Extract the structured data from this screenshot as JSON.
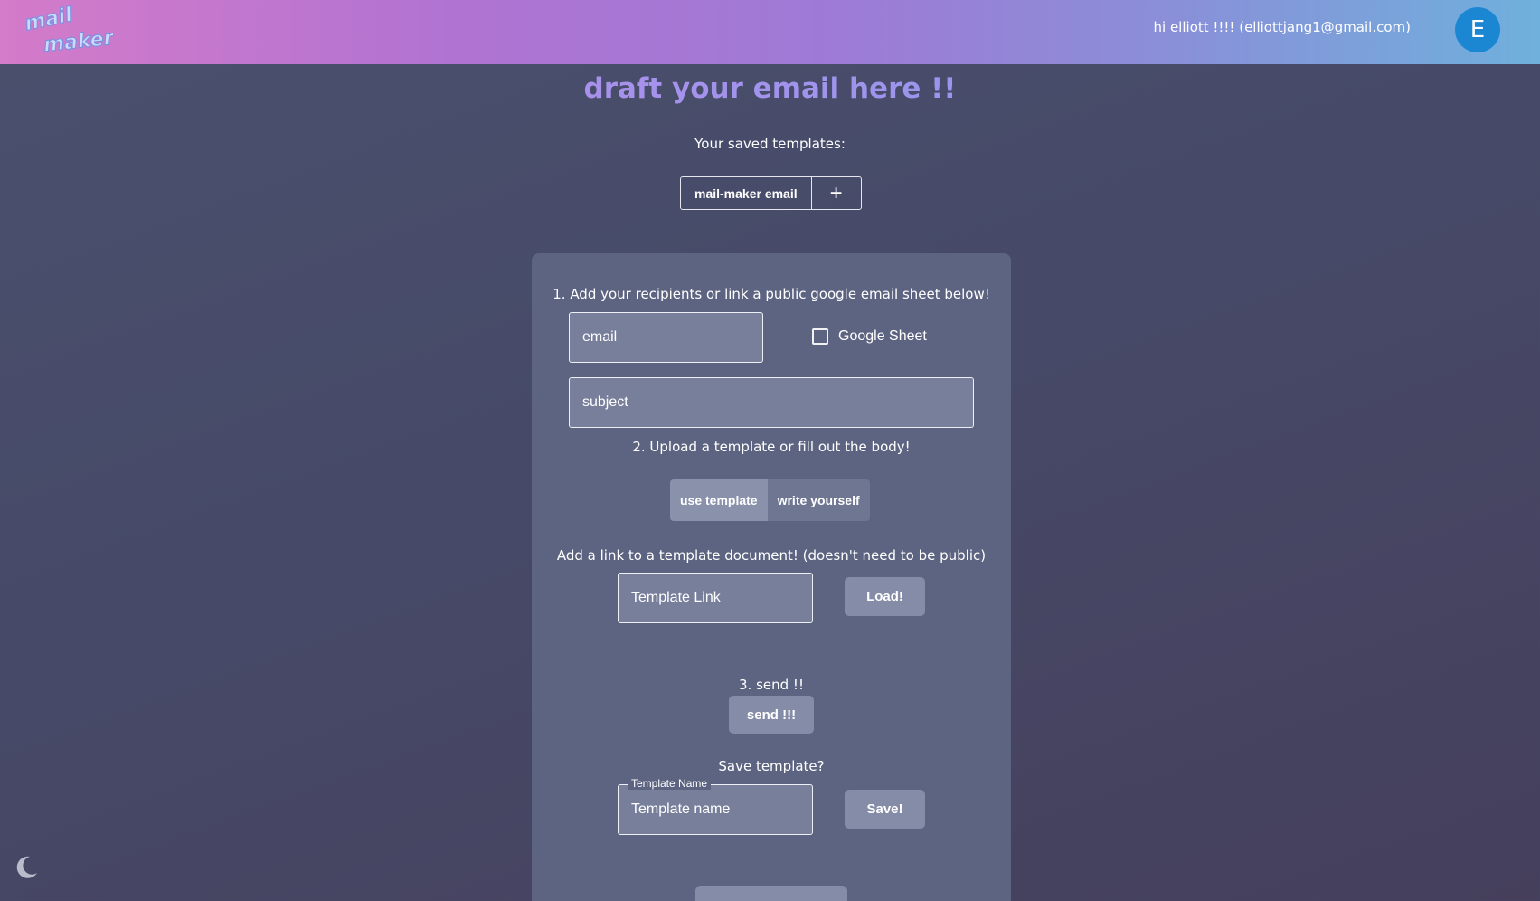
{
  "header": {
    "logo_text": "mail maker",
    "greeting": "hi elliott !!!! (elliottjang1@gmail.com)",
    "avatar_initial": "E"
  },
  "main": {
    "title": "draft your email here !!",
    "saved_templates_label": "Your saved templates:",
    "saved_templates": [
      "mail-maker email"
    ],
    "add_template_symbol": "+"
  },
  "form": {
    "step1": "1. Add your recipients or link a public google email sheet below!",
    "email_placeholder": "email",
    "google_sheet_label": "Google Sheet",
    "subject_placeholder": "subject",
    "step2": "2. Upload a template or fill out the body!",
    "mode_options": [
      "use template",
      "write yourself"
    ],
    "mode_selected": "use template",
    "template_hint": "Add a link to a template document! (doesn't need to be public)",
    "template_link_placeholder": "Template Link",
    "load_button": "Load!",
    "step3": "3. send !!",
    "send_button": "send !!!",
    "save_prompt": "Save template?",
    "template_name_label": "Template Name",
    "template_name_placeholder": "Template name",
    "save_button": "Save!"
  },
  "colors": {
    "accent_avatar": "#1b87d3",
    "card": "#5d6481",
    "button": "#858ca8"
  },
  "icons": {
    "dark_mode": "moon-icon",
    "add": "plus-icon"
  }
}
